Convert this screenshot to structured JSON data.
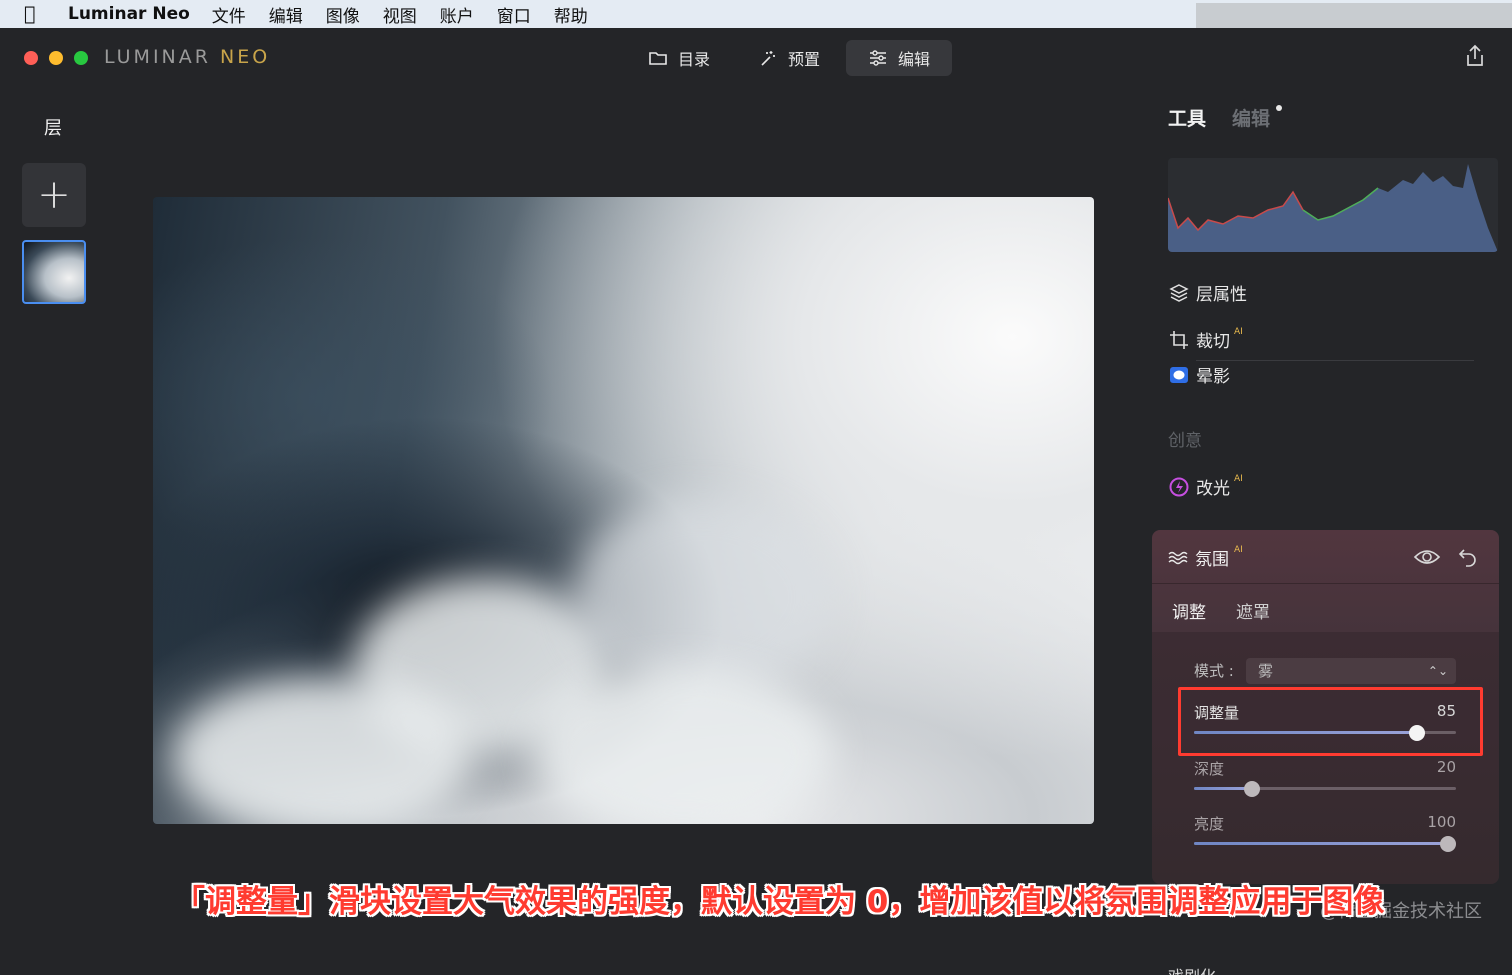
{
  "menubar": {
    "apple": "",
    "app_name": "Luminar Neo",
    "items": [
      "文件",
      "编辑",
      "图像",
      "视图",
      "账户",
      "窗口",
      "帮助"
    ]
  },
  "window": {
    "logo_left": "LUMINAR",
    "logo_right": "NEO",
    "nav": [
      {
        "label": "目录",
        "icon": "folder-icon",
        "active": false
      },
      {
        "label": "预置",
        "icon": "magic-wand-icon",
        "active": false
      },
      {
        "label": "编辑",
        "icon": "sliders-icon",
        "active": true
      }
    ]
  },
  "layers": {
    "title": "层",
    "add_label": "+"
  },
  "right_panel": {
    "tabs": {
      "tools": "工具",
      "edits": "编辑"
    },
    "tools": [
      {
        "label": "层属性",
        "icon": "layers-icon",
        "ai": ""
      },
      {
        "label": "裁切",
        "icon": "crop-icon",
        "ai": "AI"
      },
      {
        "label": "晕影",
        "icon": "vignette-icon",
        "ai": ""
      }
    ],
    "section_creative": "创意",
    "relight": {
      "label": "改光",
      "ai": "AI"
    },
    "atmosphere": {
      "title": "氛围",
      "ai": "AI",
      "subtabs": [
        "调整",
        "遮罩"
      ],
      "mode_label": "模式 :",
      "mode_value": "雾",
      "sliders": [
        {
          "label": "调整量",
          "value": "85",
          "fraction": 0.85
        },
        {
          "label": "深度",
          "value": "20",
          "fraction": 0.22
        },
        {
          "label": "亮度",
          "value": "100",
          "fraction": 0.97
        }
      ]
    },
    "bottom_tool": "戏剧化"
  },
  "caption": "「调整量」滑块设置大气效果的强度，默认设置为 0，增加该值以将氛围调整应用于图像",
  "watermark": "@稀土掘金技术社区",
  "colors": {
    "accent_blue": "#4a8ef0",
    "ai_badge": "#e6b84e",
    "highlight": "#ff3b30",
    "relight_icon": "#c64fe0"
  }
}
